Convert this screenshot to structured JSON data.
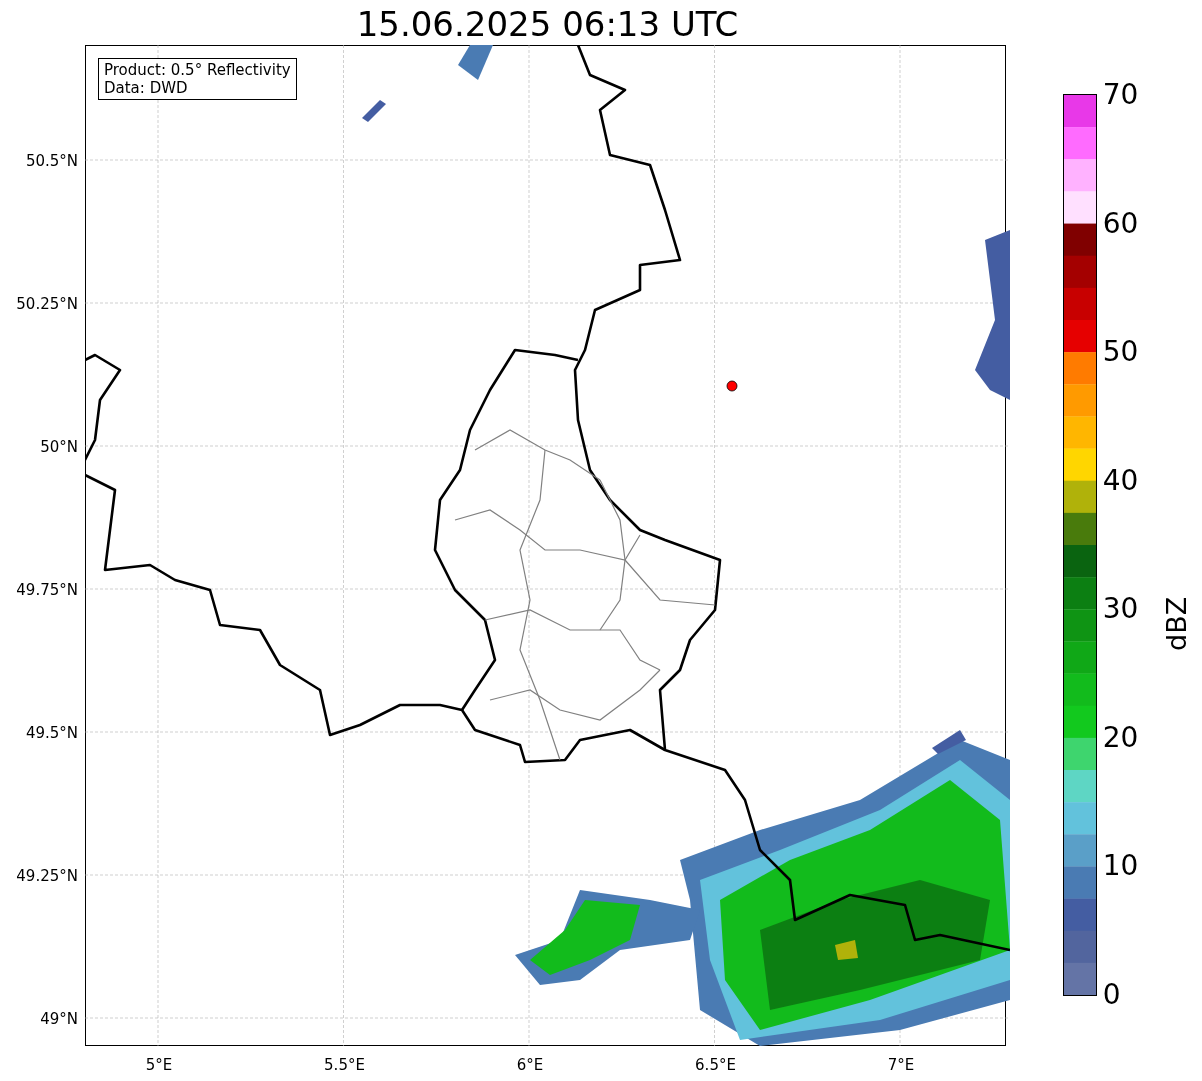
{
  "title": "15.06.2025 06:13 UTC",
  "info_box": [
    "Product: 0.5° Reflectivity",
    "Data: DWD"
  ],
  "x_ticks": [
    "5°E",
    "5.5°E",
    "6°E",
    "6.5°E",
    "7°E"
  ],
  "y_ticks": [
    "50.5°N",
    "50.25°N",
    "50°N",
    "49.75°N",
    "49.5°N",
    "49.25°N",
    "49°N"
  ],
  "colorbar": {
    "label": "dBZ",
    "ticks": [
      "70",
      "60",
      "50",
      "40",
      "30",
      "20",
      "10",
      "0"
    ],
    "bins": [
      {
        "color": "#e838e8"
      },
      {
        "color": "#ff6bff"
      },
      {
        "color": "#ffb2ff"
      },
      {
        "color": "#ffe0ff"
      },
      {
        "color": "#800000"
      },
      {
        "color": "#a40000"
      },
      {
        "color": "#c80000"
      },
      {
        "color": "#e60000"
      },
      {
        "color": "#ff7b00"
      },
      {
        "color": "#ff9a00"
      },
      {
        "color": "#ffb600"
      },
      {
        "color": "#ffd600"
      },
      {
        "color": "#b0b20a"
      },
      {
        "color": "#497b0c"
      },
      {
        "color": "#0a6410"
      },
      {
        "color": "#0c7f12"
      },
      {
        "color": "#0f9414"
      },
      {
        "color": "#10a817"
      },
      {
        "color": "#12bb1c"
      },
      {
        "color": "#12c91e"
      },
      {
        "color": "#3ed56e"
      },
      {
        "color": "#5ed6c4"
      },
      {
        "color": "#62c2dc"
      },
      {
        "color": "#5a9fc8"
      },
      {
        "color": "#4a7bb3"
      },
      {
        "color": "#445da2"
      },
      {
        "color": "#52659e"
      },
      {
        "color": "#6474a6"
      }
    ]
  }
}
